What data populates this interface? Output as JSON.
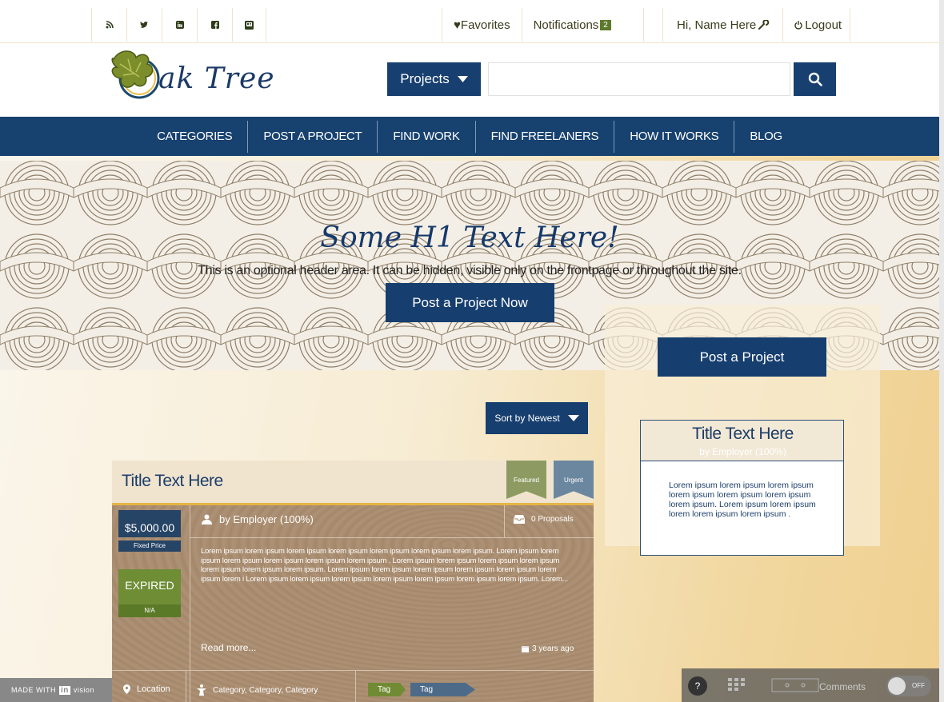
{
  "topbar": {
    "social_icons": [
      "rss-icon",
      "twitter-icon",
      "linkedin-icon",
      "facebook-icon",
      "contact-icon"
    ],
    "favorites_label": "♥Favorites",
    "notifications_label": "Notifications",
    "notifications_count": "2",
    "user_greeting": "Hi, Name Here",
    "logout_label": "Logout"
  },
  "header": {
    "logo_text": "ak Tree",
    "search_type_label": "Projects",
    "search_placeholder": ""
  },
  "nav": {
    "items": [
      "CATEGORIES",
      "POST A PROJECT",
      "FIND WORK",
      "FIND FREELANERS",
      "HOW IT WORKS",
      "BLOG"
    ]
  },
  "hero": {
    "title": "Some H1 Text Here!",
    "subtitle": "This is an optional header area.  It can be hidden, visible only on the frontpage or throughout the site.",
    "cta_label": "Post a Project Now"
  },
  "sort": {
    "label": "Sort by Newest"
  },
  "listing": {
    "title": "Title Text Here",
    "ribbon_featured": "Featured",
    "ribbon_urgent": "Urgent",
    "price": "$5,000.00",
    "price_type": "Fixed Price",
    "status": "EXPIRED",
    "status_sub": "N/A",
    "employer": "by Employer (100%)",
    "proposals": "0 Proposals",
    "description": "Lorem ipsum lorem ipsum lorem ipsum lorem ipsum lorem ipsum lorem ipsum lorem ipsum. Lorem ipsum lorem ipsum lorem ipsum lorem ipsum lorem ipsum lorem ipsum . Lorem ipsum lorem ipsum lorem ipsum lorem ipsum lorem ipsum lorem ipsum lorem ipsum. Lorem ipsum lorem ipsum lorem ipsum lorem ipsum lorem ipsum lorem ipsum lorem i Lorem ipsum lorem ipsum lorem ipsum lorem ipsum lorem ipsum lorem ipsum lorem ipsum. Lorem...",
    "read_more": "Read more...",
    "posted": "3 years ago",
    "location": "Location",
    "categories": "Category, Category, Category",
    "tags": [
      "Tag",
      "Tag"
    ]
  },
  "sidebar": {
    "post_button": "Post a Project",
    "card_title": "Title Text Here",
    "card_employer": "by Employer (100%)",
    "card_body": "Lorem ipsum lorem ipsum lorem ipsum lorem ipsum lorem ipsum lorem ipsum lorem ipsum. Lorem ipsum lorem ipsum lorem lorem ipsum lorem ipsum ."
  },
  "overlay": {
    "made_with": "MADE WITH",
    "brand": "in",
    "brand_suffix": "vision",
    "help": "?",
    "comments": "Comments",
    "toggle": "OFF"
  },
  "colors": {
    "navy": "#173f6f",
    "olive": "#6e8d35",
    "gold": "#e6b446"
  }
}
